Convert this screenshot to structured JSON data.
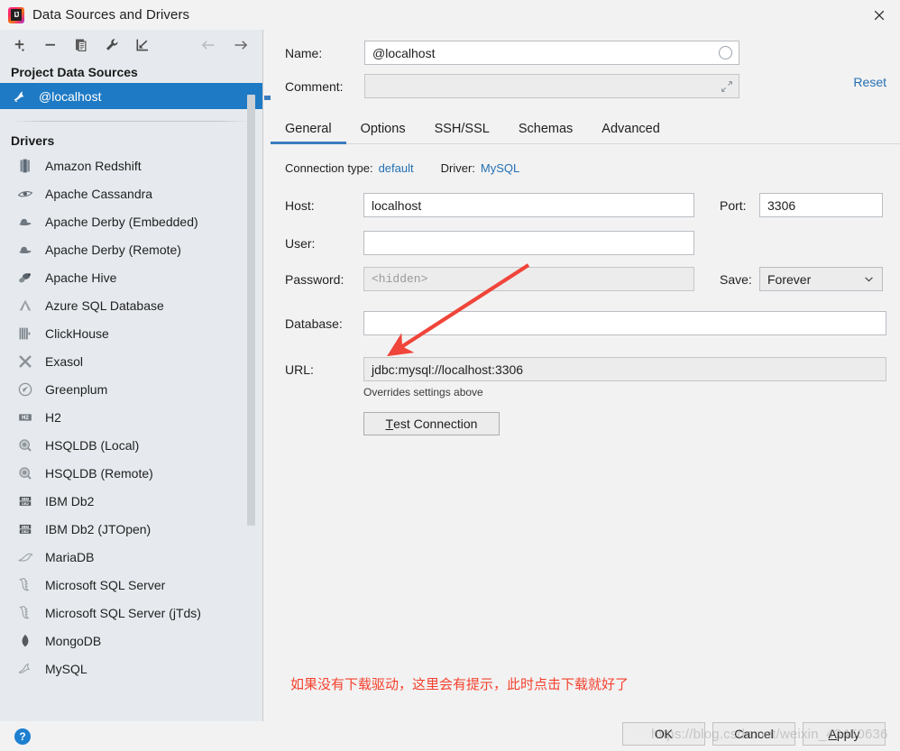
{
  "window": {
    "title": "Data Sources and Drivers",
    "logo_icon": "intellij-idea-logo",
    "close_icon": "close-icon"
  },
  "toolbar": {
    "add_icon": "plus-icon",
    "remove_icon": "minus-icon",
    "copy_icon": "copy-icon",
    "properties_icon": "wrench-icon",
    "import_icon": "import-icon",
    "back_icon": "arrow-left-icon",
    "forward_icon": "arrow-right-icon"
  },
  "sidebar": {
    "project_heading": "Project Data Sources",
    "data_sources": [
      {
        "label": "@localhost",
        "icon": "mysql-dolphin-icon",
        "selected": true
      }
    ],
    "drivers_heading": "Drivers",
    "drivers": [
      {
        "label": "Amazon Redshift",
        "icon": "redshift-icon"
      },
      {
        "label": "Apache Cassandra",
        "icon": "cassandra-eye-icon"
      },
      {
        "label": "Apache Derby (Embedded)",
        "icon": "derby-hat-icon"
      },
      {
        "label": "Apache Derby (Remote)",
        "icon": "derby-hat-icon"
      },
      {
        "label": "Apache Hive",
        "icon": "hive-bee-icon"
      },
      {
        "label": "Azure SQL Database",
        "icon": "azure-icon"
      },
      {
        "label": "ClickHouse",
        "icon": "clickhouse-icon"
      },
      {
        "label": "Exasol",
        "icon": "exasol-x-icon"
      },
      {
        "label": "Greenplum",
        "icon": "greenplum-icon"
      },
      {
        "label": "H2",
        "icon": "h2-icon"
      },
      {
        "label": "HSQLDB (Local)",
        "icon": "hsqldb-icon"
      },
      {
        "label": "HSQLDB (Remote)",
        "icon": "hsqldb-icon"
      },
      {
        "label": "IBM Db2",
        "icon": "ibm-db2-icon"
      },
      {
        "label": "IBM Db2 (JTOpen)",
        "icon": "ibm-db2-icon"
      },
      {
        "label": "MariaDB",
        "icon": "mariadb-seal-icon"
      },
      {
        "label": "Microsoft SQL Server",
        "icon": "mssql-icon"
      },
      {
        "label": "Microsoft SQL Server (jTds)",
        "icon": "mssql-icon"
      },
      {
        "label": "MongoDB",
        "icon": "mongodb-leaf-icon"
      },
      {
        "label": "MySQL",
        "icon": "mysql-dolphin-icon"
      }
    ]
  },
  "header": {
    "name_label": "Name:",
    "name_value": "@localhost",
    "name_color_icon": "color-circle-icon",
    "comment_label": "Comment:",
    "comment_value": "",
    "comment_expand_icon": "expand-icon",
    "reset_label": "Reset"
  },
  "tabs": [
    {
      "label": "General",
      "active": true
    },
    {
      "label": "Options",
      "active": false
    },
    {
      "label": "SSH/SSL",
      "active": false
    },
    {
      "label": "Schemas",
      "active": false
    },
    {
      "label": "Advanced",
      "active": false
    }
  ],
  "connection": {
    "type_label": "Connection type:",
    "type_value": "default",
    "driver_label": "Driver:",
    "driver_value": "MySQL",
    "host_label": "Host:",
    "host_value": "localhost",
    "port_label": "Port:",
    "port_value": "3306",
    "user_label": "User:",
    "user_value": "",
    "password_label": "Password:",
    "password_placeholder": "<hidden>",
    "save_label": "Save:",
    "save_value": "Forever",
    "save_chevron_icon": "chevron-down-icon",
    "database_label": "Database:",
    "database_value": "",
    "url_label": "URL:",
    "url_value": "jdbc:mysql://localhost:3306",
    "url_hint": "Overrides settings above",
    "test_connection_mnemonic": "T",
    "test_connection_rest": "est Connection"
  },
  "annotation": {
    "text": "如果没有下载驱动，这里会有提示，此时点击下载就好了",
    "arrow_icon": "arrow-pointer-icon",
    "color": "#f5412e"
  },
  "footer": {
    "help_icon": "help-icon",
    "help_glyph": "?",
    "buttons": [
      {
        "label": "OK",
        "mnemonic": "",
        "rest": "OK"
      },
      {
        "label": "Cancel",
        "mnemonic": "",
        "rest": "Cancel"
      },
      {
        "label": "Apply",
        "mnemonic": "A",
        "rest": "pply"
      }
    ]
  },
  "watermark": {
    "text": "https://blog.csdn.net/weixin_43450636"
  },
  "colors": {
    "accent": "#1e7ac4",
    "link": "#2470b3",
    "tab_underline": "#3b7dbf",
    "annotation_red": "#f5412e",
    "sidebar_bg": "#e6eaee",
    "panel_bg": "#f2f2f2"
  }
}
